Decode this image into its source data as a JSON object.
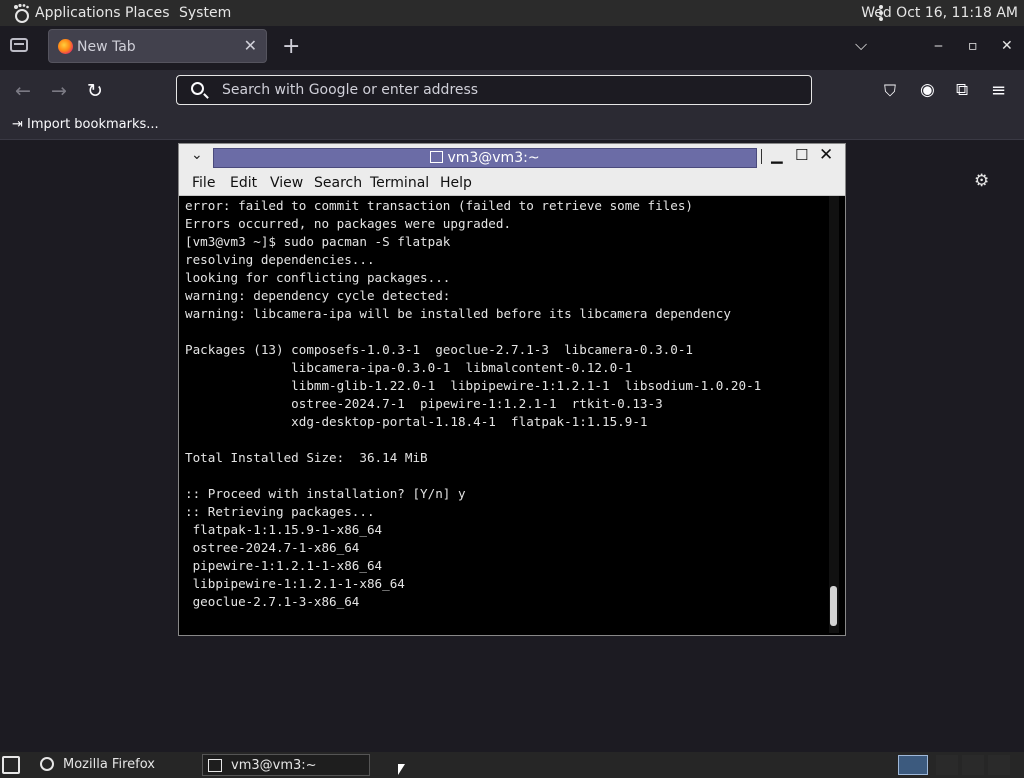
{
  "top_panel": {
    "menu_applications": "Applications",
    "menu_places": "Places",
    "menu_system": "System",
    "clock": "Wed Oct 16, 11:18 AM"
  },
  "browser": {
    "tab_label": "New Tab",
    "tab_close": "✕",
    "new_tab": "+",
    "list_all_tabs": "⌵",
    "minimize": "‒",
    "maximize": "▫",
    "close": "✕",
    "back": "←",
    "forward": "→",
    "reload": "↻",
    "url_placeholder": "Search with Google or enter address",
    "pocket": "⛉",
    "account": "◉",
    "extensions": "⧉",
    "menu": "≡",
    "import_bookmarks": "⇥ Import bookmarks...",
    "settings": "⚙"
  },
  "terminal": {
    "title": "vm3@vm3:~",
    "dropdown": "⌄",
    "minimize": "▁",
    "maximize": "☐",
    "close": "✕",
    "menu": [
      "File",
      "Edit",
      "View",
      "Search",
      "Terminal",
      "Help"
    ],
    "lines": [
      "error: failed to commit transaction (failed to retrieve some files)",
      "Errors occurred, no packages were upgraded.",
      "[vm3@vm3 ~]$ sudo pacman -S flatpak",
      "resolving dependencies...",
      "looking for conflicting packages...",
      "warning: dependency cycle detected:",
      "warning: libcamera-ipa will be installed before its libcamera dependency",
      "",
      "Packages (13) composefs-1.0.3-1  geoclue-2.7.1-3  libcamera-0.3.0-1",
      "              libcamera-ipa-0.3.0-1  libmalcontent-0.12.0-1",
      "              libmm-glib-1.22.0-1  libpipewire-1:1.2.1-1  libsodium-1.0.20-1",
      "              ostree-2024.7-1  pipewire-1:1.2.1-1  rtkit-0.13-3",
      "              xdg-desktop-portal-1.18.4-1  flatpak-1:1.15.9-1",
      "",
      "Total Installed Size:  36.14 MiB",
      "",
      ":: Proceed with installation? [Y/n] y",
      ":: Retrieving packages...",
      " flatpak-1:1.15.9-1-x86_64",
      " ostree-2024.7-1-x86_64",
      " pipewire-1:1.2.1-1-x86_64",
      " libpipewire-1:1.2.1-1-x86_64",
      " geoclue-2.7.1-3-x86_64"
    ]
  },
  "taskbar": {
    "firefox": "Mozilla Firefox",
    "terminal": "vm3@vm3:~"
  }
}
